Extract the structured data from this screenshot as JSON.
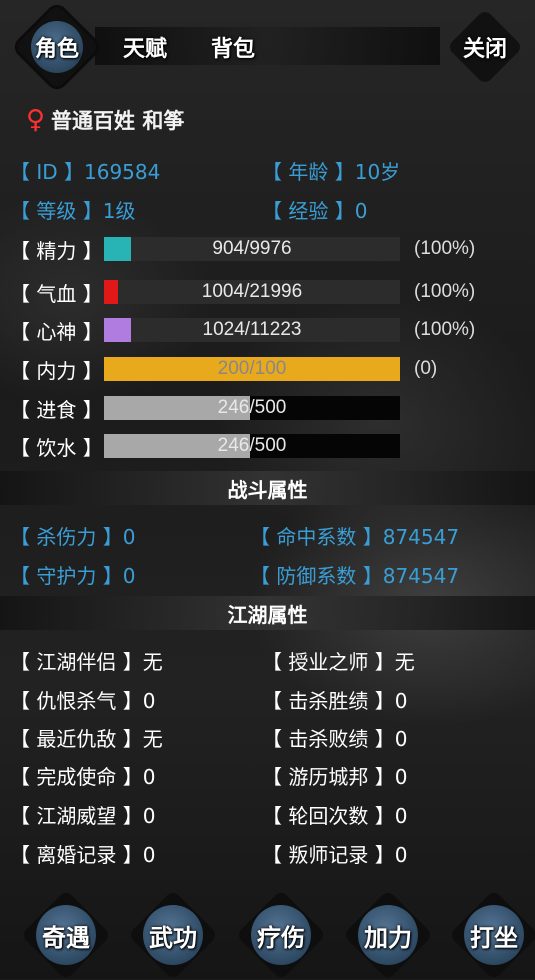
{
  "tabs": {
    "role": "角色",
    "talent": "天赋",
    "bag": "背包",
    "close": "关闭"
  },
  "player": {
    "gender_symbol": "♀",
    "name": "普通百姓 和筝"
  },
  "info": {
    "id": "【  ID  】169584",
    "age": "【 年龄 】10岁",
    "level": "【 等级 】1级",
    "exp": "【 经验 】0"
  },
  "stats": [
    {
      "label": "【 精力 】",
      "value": "904/9976",
      "fill": 0.09,
      "color": "#28b4b4",
      "pct": "(100%)"
    },
    {
      "label": "【 气血 】",
      "value": "1004/21996",
      "fill": 0.046,
      "color": "#e01818",
      "pct": "(100%)"
    },
    {
      "label": "【 心神 】",
      "value": "1024/11223",
      "fill": 0.091,
      "color": "#b07ce0",
      "pct": "(100%)"
    },
    {
      "label": "【 内力 】",
      "value": "200/100",
      "fill": 1.0,
      "color": "#e8aa1c",
      "pct": "(0)"
    },
    {
      "label": "【 进食 】",
      "value": "246/500",
      "fill": 0.492,
      "color": "#a8a8a8",
      "pct": ""
    },
    {
      "label": "【 饮水 】",
      "value": "246/500",
      "fill": 0.492,
      "color": "#a8a8a8",
      "pct": ""
    }
  ],
  "combat": {
    "title": "战斗属性",
    "kill": "【 杀伤力 】0",
    "hit": "【 命中系数 】874547",
    "guard": "【 守护力 】0",
    "defense": "【 防御系数 】874547"
  },
  "jianghu": {
    "title": "江湖属性",
    "left": [
      "【 江湖伴侣 】无",
      "【 仇恨杀气 】0",
      "【 最近仇敌 】无",
      "【 完成使命 】0",
      "【 江湖威望 】0",
      "【 离婚记录 】0"
    ],
    "right": [
      "【 授业之师 】无",
      "【 击杀胜绩 】0",
      "【 击杀败绩 】0",
      "【 游历城邦 】0",
      "【 轮回次数 】0",
      "【 叛师记录 】0"
    ]
  },
  "bottom": [
    "奇遇",
    "武功",
    "疗伤",
    "加力",
    "打坐"
  ]
}
